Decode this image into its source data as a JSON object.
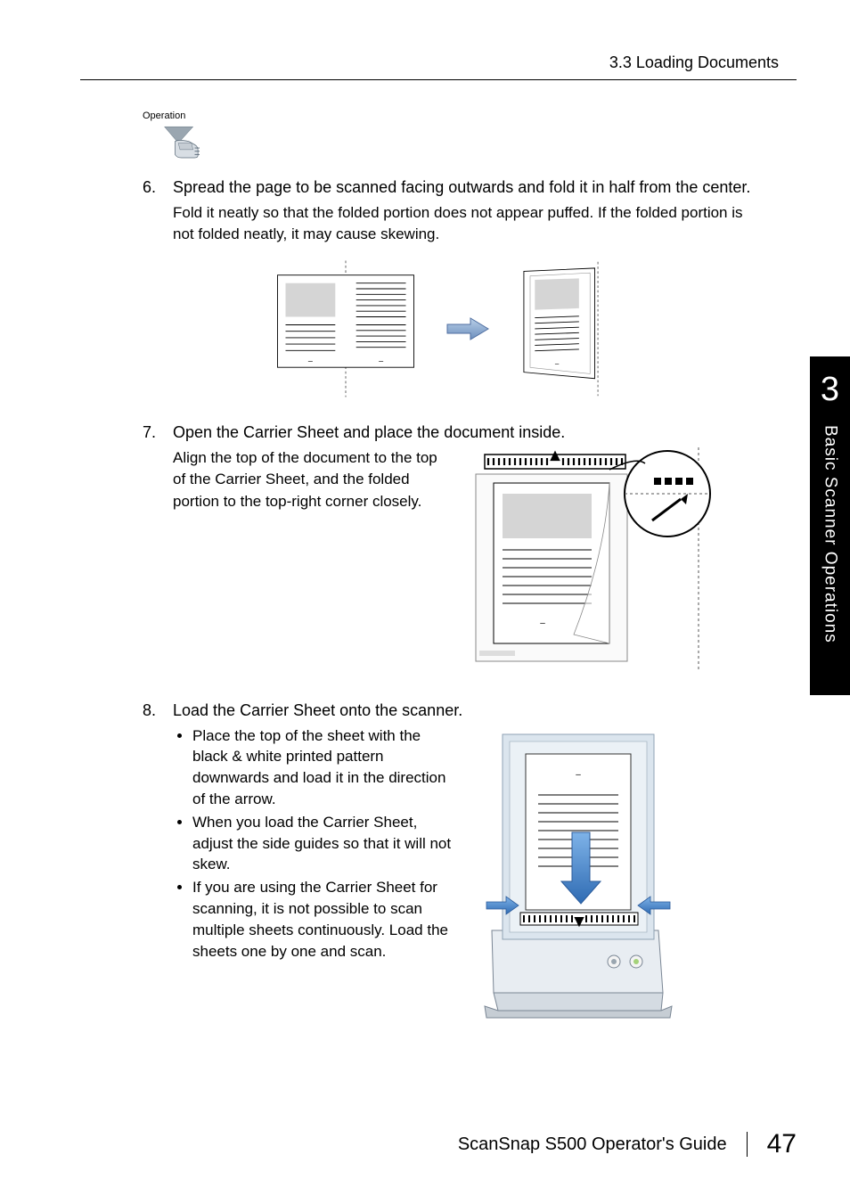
{
  "header": {
    "section_title": "3.3 Loading Documents"
  },
  "operation": {
    "label": "Operation"
  },
  "steps": {
    "s6": {
      "num": "6.",
      "title": "Spread the page to be scanned facing outwards and fold it in half from the center.",
      "body": "Fold it neatly so that the folded portion does not appear puffed. If the folded portion is not folded neatly, it may cause skewing."
    },
    "s7": {
      "num": "7.",
      "title": "Open the Carrier Sheet and place the document inside.",
      "body": "Align the top of the document to the top of the Carrier Sheet, and the folded portion to the top-right corner closely."
    },
    "s8": {
      "num": "8.",
      "title": "Load the Carrier Sheet onto the scanner.",
      "bullets": [
        "Place the top of the sheet with the black & white printed pattern downwards and load it in the direction of the arrow.",
        "When you load the Carrier Sheet, adjust the side guides so that it will not skew.",
        "If you are using the Carrier Sheet for scanning, it is not possible to scan multiple sheets continuously. Load the sheets one by one and scan."
      ]
    }
  },
  "side_tab": {
    "chapter_num": "3",
    "chapter_title": "Basic Scanner Operations"
  },
  "footer": {
    "doc_title": "ScanSnap S500 Operator's Guide",
    "page_num": "47"
  }
}
